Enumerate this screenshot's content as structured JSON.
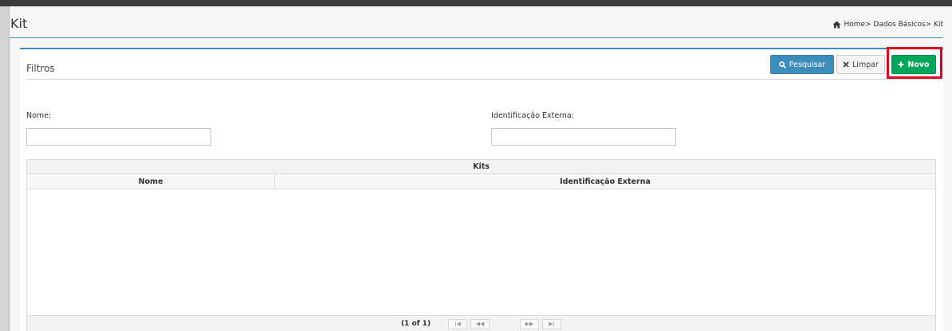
{
  "page": {
    "title": "Kit"
  },
  "breadcrumb": {
    "text": "Home> Dados Básicos> Kit",
    "icon": "home-icon"
  },
  "filters": {
    "title": "Filtros",
    "buttons": {
      "search": {
        "label": "Pesquisar",
        "icon": "search-icon",
        "color": "#3c8dbc"
      },
      "clear": {
        "label": "Limpar",
        "icon": "close-icon",
        "color": "#f4f4f4"
      },
      "new": {
        "label": "Novo",
        "icon": "plus-icon",
        "color": "#00a65a"
      }
    },
    "fields": {
      "nome": {
        "label": "Nome:",
        "value": "",
        "placeholder": ""
      },
      "identificacao": {
        "label": "Identificação Externa:",
        "value": "",
        "placeholder": ""
      }
    }
  },
  "grid": {
    "caption": "Kits",
    "columns": [
      "Nome",
      "Identificação Externa"
    ],
    "rows": [],
    "paginator": {
      "report": "(1 of 1)",
      "first": "|◀",
      "prev": "◀◀",
      "next": "▶▶",
      "last": "▶|"
    }
  },
  "highlight_color": "#e3001b"
}
